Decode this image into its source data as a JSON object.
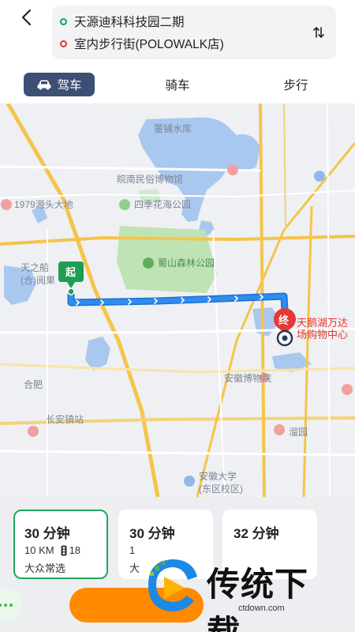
{
  "header": {
    "origin": "天源迪科科技园二期",
    "destination": "室内步行街(POLOWALK店)"
  },
  "tabs": [
    {
      "label": "驾车",
      "active": true
    },
    {
      "label": "骑车",
      "active": false
    },
    {
      "label": "步行",
      "active": false
    }
  ],
  "map": {
    "start_marker": "起",
    "end_marker": "终",
    "labels": {
      "poi_museum": "皖南民俗博物馆",
      "poi_park_four": "四季花海公园",
      "poi_forest": "蜀山森林公园",
      "poi_wanda_1": "天鹅湖万达",
      "poi_wanda_2": "场购物中心",
      "poi_anhui_museum": "安徽博物院",
      "poi_anhui_uni": "安徽大学",
      "poi_uni_campus": "(东区校区)",
      "poi_changan": "长安镇站",
      "poi_1979": "1979源头大地",
      "poi_mall_left": "天之船",
      "poi_mall_left_2": "(合)阅果",
      "poi_hefei": "合肥",
      "poi_jingyuan": "溜园",
      "poi_top_center": "董铺水库"
    }
  },
  "routes": [
    {
      "time": "30 分钟",
      "distance": "10 KM",
      "lights": "18",
      "tag": "大众常选",
      "selected": true
    },
    {
      "time": "30 分钟",
      "distance": "1",
      "lights": "",
      "tag": "大",
      "selected": false
    },
    {
      "time": "32 分钟",
      "distance": "",
      "lights": "",
      "tag": "",
      "selected": false
    }
  ],
  "watermark": {
    "title": "传统下载",
    "url": "ctdown.com"
  },
  "colors": {
    "accent_drive": "#3d4f74",
    "selected_border": "#1fa85d",
    "route_line": "#1e88e5",
    "start_green": "#1f9d55",
    "end_red": "#e53935",
    "nav_button": "#ff8a00"
  }
}
